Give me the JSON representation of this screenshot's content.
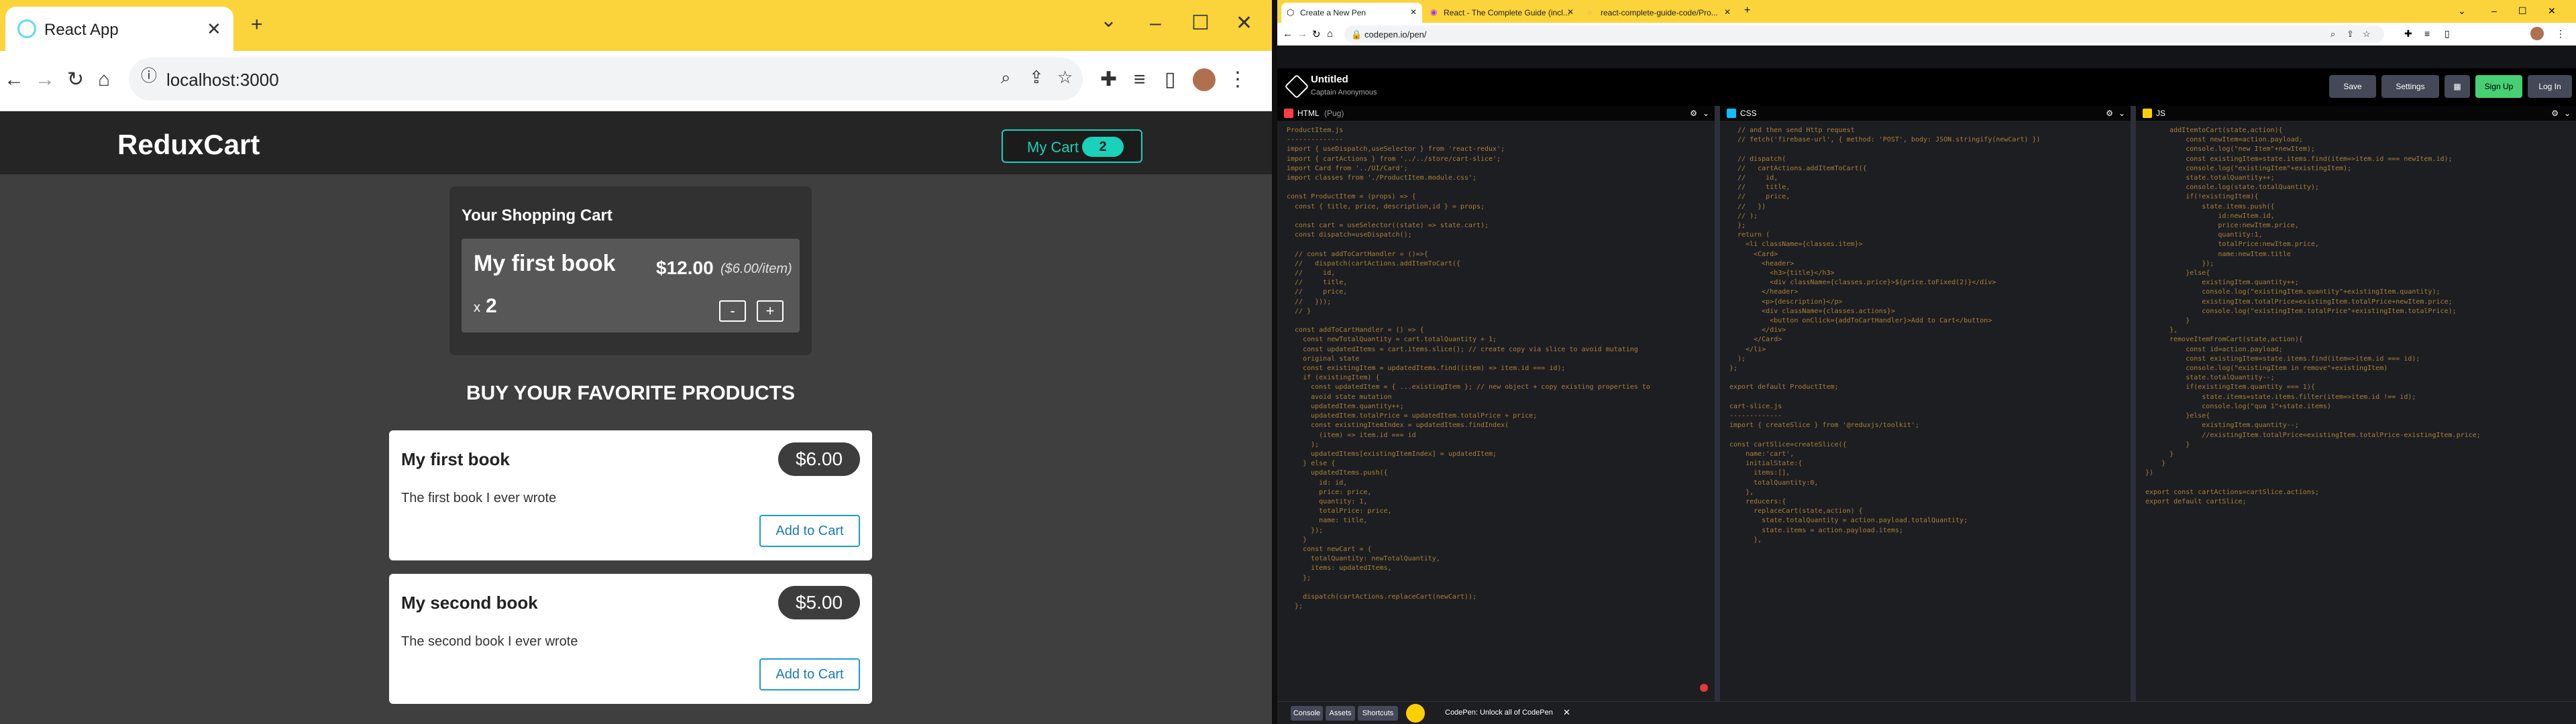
{
  "left_browser": {
    "tab_title": "React App",
    "url": "localhost:3000",
    "app": {
      "brand": "ReduxCart",
      "cart_button": {
        "label": "My Cart",
        "badge": "2"
      },
      "cart_panel": {
        "title": "Your Shopping Cart",
        "item": {
          "title": "My first book",
          "total": "$12.00",
          "unit_price": "($6.00/item)",
          "qty_prefix": "x",
          "qty": "2",
          "minus": "-",
          "plus": "+"
        }
      },
      "products_heading": "BUY YOUR FAVORITE PRODUCTS",
      "products": [
        {
          "title": "My first book",
          "price": "$6.00",
          "description": "The first book I ever wrote",
          "add_label": "Add to Cart"
        },
        {
          "title": "My second book",
          "price": "$5.00",
          "description": "The second book I ever wrote",
          "add_label": "Add to Cart"
        }
      ]
    }
  },
  "right_browser": {
    "tabs": [
      {
        "title": "Create a New Pen"
      },
      {
        "title": "React - The Complete Guide (incl..."
      },
      {
        "title": "react-complete-guide-code/Pro..."
      }
    ],
    "url": "codepen.io/pen/",
    "codepen": {
      "title": "Untitled",
      "author": "Captain Anonymous",
      "buttons": {
        "save": "Save",
        "settings": "Settings",
        "signup": "Sign Up",
        "login": "Log In"
      },
      "editors": [
        {
          "lang": "HTML",
          "note": "(Pug)",
          "code": [
            "ProductItem.js",
            "--------------",
            "import { useDispatch,useSelector } from 'react-redux';",
            "import { cartActions } from '../../store/cart-slice';",
            "import Card from '../UI/Card';",
            "import classes from './ProductItem.module.css';",
            "",
            "const ProductItem = (props) => {",
            "  const { title, price, description,id } = props;",
            "",
            "  const cart = useSelector((state) => state.cart);",
            "  const dispatch=useDispatch();",
            "",
            "  // const addToCartHandler = ()=>{",
            "  //   dispatch(cartActions.addItemToCart({",
            "  //     id,",
            "  //     title,",
            "  //     price,",
            "  //   }));",
            "  // }",
            "",
            "  const addToCartHandler = () => {",
            "    const newTotalQuantity = cart.totalQuantity + 1;",
            "    const updatedItems = cart.items.slice(); // create copy via slice to avoid mutating",
            "    original state",
            "    const existingItem = updatedItems.find((item) => item.id === id);",
            "    if (existingItem) {",
            "      const updatedItem = { ...existingItem }; // new object + copy existing properties to",
            "      avoid state mutation",
            "      updatedItem.quantity++;",
            "      updatedItem.totalPrice = updatedItem.totalPrice + price;",
            "      const existingItemIndex = updatedItems.findIndex(",
            "        (item) => item.id === id",
            "      );",
            "      updatedItems[existingItemIndex] = updatedItem;",
            "    } else {",
            "      updatedItems.push({",
            "        id: id,",
            "        price: price,",
            "        quantity: 1,",
            "        totalPrice: price,",
            "        name: title,",
            "      });",
            "    }",
            "    const newCart = {",
            "      totalQuantity: newTotalQuantity,",
            "      items: updatedItems,",
            "    };",
            "",
            "    dispatch(cartActions.replaceCart(newCart));",
            "  };"
          ]
        },
        {
          "lang": "CSS",
          "note": "",
          "code": [
            "  // and then send Http request",
            "  // fetch('firebase-url', { method: 'POST', body: JSON.stringify(newCart) })",
            "",
            "  // dispatch(",
            "  //   cartActions.addItemToCart({",
            "  //     id,",
            "  //     title,",
            "  //     price,",
            "  //   })",
            "  // );",
            "  };",
            "  return (",
            "    <li className={classes.item}>",
            "      <Card>",
            "        <header>",
            "          <h3>{title}</h3>",
            "          <div className={classes.price}>${price.toFixed(2)}</div>",
            "        </header>",
            "        <p>{description}</p>",
            "        <div className={classes.actions}>",
            "          <button onClick={addToCartHandler}>Add to Cart</button>",
            "        </div>",
            "      </Card>",
            "    </li>",
            "  );",
            "};",
            "",
            "export default ProductItem;",
            "",
            "cart-slice.js",
            "-------------",
            "import { createSlice } from '@reduxjs/toolkit';",
            "",
            "const cartSlice=createSlice({",
            "    name:'cart',",
            "    initialState:{",
            "      items:[],",
            "      totalQuantity:0,",
            "    },",
            "    reducers:{",
            "      replaceCart(state,action) {",
            "        state.totalQuantity = action.payload.totalQuantity;",
            "        state.items = action.payload.items;",
            "      },"
          ]
        },
        {
          "lang": "JS",
          "note": "",
          "code": [
            "      addItemtoCart(state,action){",
            "          const newItem=action.payload;",
            "          console.log(\"new Item\"+newItem);",
            "          const existingItem=state.items.find(item=>item.id === newItem.id);",
            "          console.log(\"existingItem\"+existingItem);",
            "          state.totalQuantity++;",
            "          console.log(state.totalQuantity);",
            "          if(!existingItem){",
            "              state.items.push({",
            "                  id:newItem.id,",
            "                  price:newItem.price,",
            "                  quantity:1,",
            "                  totalPrice:newItem.price,",
            "                  name:newItem.title",
            "              });",
            "          }else{",
            "              existingItem.quantity++;",
            "              console.log(\"existingItem.quantity\"+existingItem.quantity);",
            "              existingItem.totalPrice=existingItem.totalPrice+newItem.price;",
            "              console.log(\"existingItem.totalPrice\"+existingItem.totalPrice);",
            "          }",
            "      },",
            "      removeItemFromCart(state,action){",
            "          const id=action.payload;",
            "          const existingItem=state.items.find(item=>item.id === id);",
            "          console.log(\"existingItem in remove\"+existingItem)",
            "          state.totalQuantity--;",
            "          if(existingItem.quantity === 1){",
            "              state.items=state.items.filter(item=>item.id !== id);",
            "              console.log(\"qua 1\"+state.items)",
            "          }else{",
            "              existingItem.quantity--;",
            "              //existingItem.totalPrice=existingItem.totalPrice-existingItem.price;",
            "          }",
            "      }",
            "    }",
            "})",
            "",
            "export const cartActions=cartSlice.actions;",
            "export default cartSlice;"
          ]
        }
      ],
      "footer": {
        "console": "Console",
        "assets": "Assets",
        "shortcuts": "Shortcuts",
        "promo": "CodePen: Unlock all of CodePen"
      }
    }
  }
}
